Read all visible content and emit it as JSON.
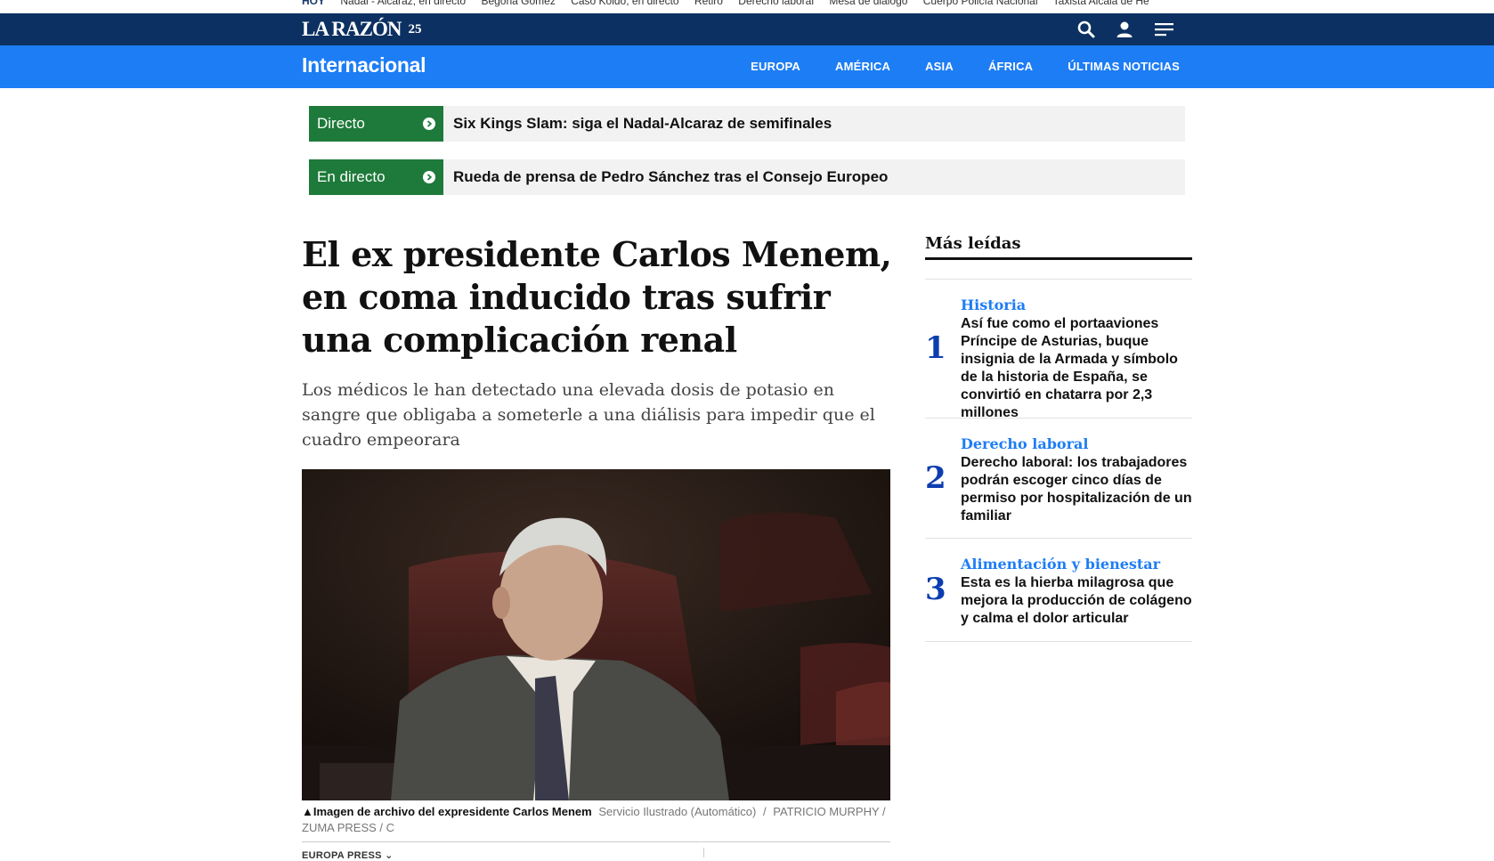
{
  "hot_bar": {
    "label": "HOY",
    "items": [
      "Nadal - Alcaraz, en directo",
      "Begoña Gómez",
      "Caso Koldo, en directo",
      "Retiro",
      "Derecho laboral",
      "Mesa de diálogo",
      "Cuerpo Policía Nacional",
      "Taxista Alcalá de He"
    ]
  },
  "header": {
    "logo_text": "LA RAZÓN",
    "logo_badge": "25",
    "icons": {
      "search": "search-icon",
      "user": "user-icon",
      "menu": "menu-icon"
    }
  },
  "section": {
    "title": "Internacional",
    "nav": [
      "EUROPA",
      "AMÉRICA",
      "ASIA",
      "ÁFRICA",
      "ÚLTIMAS NOTICIAS"
    ]
  },
  "live": [
    {
      "tag": "Directo",
      "headline": "Six Kings Slam: siga el Nadal-Alcaraz de semifinales"
    },
    {
      "tag": "En directo",
      "headline": "Rueda de prensa de Pedro Sánchez tras el Consejo Europeo"
    }
  ],
  "article": {
    "headline": "El ex presidente Carlos Menem, en coma inducido tras sufrir una complicación renal",
    "summary": "Los médicos le han detectado una elevada dosis de potasio en sangre que obligaba a someterle a una diálisis para impedir que el cuadro empeorara",
    "caption": {
      "title": "Imagen de archivo del expresidente Carlos Menem",
      "credit1": "Servicio Ilustrado (Automático)",
      "separator": "/",
      "credit2": "PATRICIO MURPHY / ZUMA PRESS / C"
    },
    "byline": "EUROPA PRESS"
  },
  "most_read": {
    "title": "Más leídas",
    "items": [
      {
        "number": "1",
        "category": "Historia",
        "text": "Así fue como el portaaviones Príncipe de Asturias, buque insignia de la Armada y símbolo de la historia de España, se convirtió en chatarra por 2,3 millones"
      },
      {
        "number": "2",
        "category": "Derecho laboral",
        "text": "Derecho laboral: los trabajadores podrán escoger cinco días de permiso por hospitalización de un familiar"
      },
      {
        "number": "3",
        "category": "Alimentación y bienestar",
        "text": "Esta es la hierba milagrosa que mejora la producción de colágeno y calma el dolor articular"
      }
    ]
  },
  "colors": {
    "header_bg": "#0c3061",
    "section_bg": "#1d7df5",
    "live_green": "#1e7a3a",
    "number_blue": "#0c3db0"
  }
}
